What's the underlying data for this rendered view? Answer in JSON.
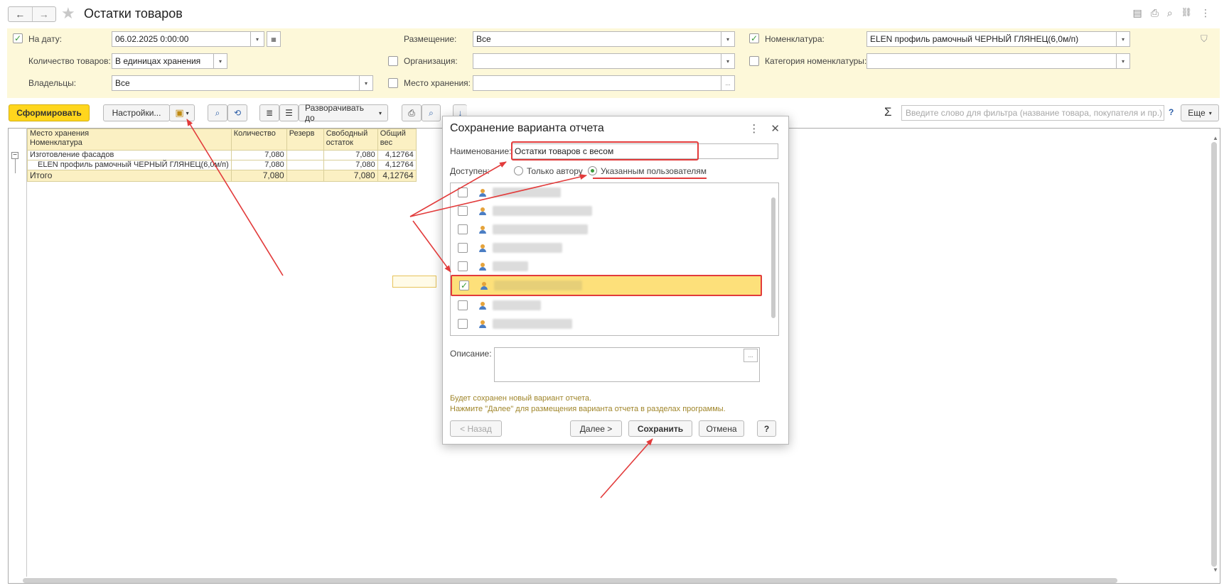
{
  "window": {
    "title": "Остатки товаров",
    "back_icon": "←",
    "forward_icon": "→",
    "star_icon": "★",
    "icons": [
      "save-icon",
      "print-icon",
      "preview-icon",
      "link-icon",
      "more-icon"
    ],
    "icon_glyphs": [
      "▤",
      "⎙",
      "⌕",
      "🔗",
      "⋮"
    ]
  },
  "filters": {
    "date": {
      "label": "На дату:",
      "value": "06.02.2025  0:00:00",
      "checked": true
    },
    "qty": {
      "label": "Количество товаров:",
      "value": "В единицах хранения"
    },
    "owners": {
      "label": "Владельцы:",
      "value": "Все"
    },
    "placement": {
      "label": "Размещение:",
      "value": "Все"
    },
    "org": {
      "label": "Организация:",
      "value": ""
    },
    "storage": {
      "label": "Место хранения:",
      "value": ""
    },
    "nomenclature": {
      "label": "Номенклатура:",
      "value": "ELEN профиль рамочный  ЧЕРНЫЙ ГЛЯНЕЦ(6,0м/п)",
      "checked": true
    },
    "category": {
      "label": "Категория номенклатуры:",
      "value": ""
    },
    "ellipsis": "...",
    "dd": "▾",
    "cal": "▦",
    "check": "✓",
    "funnel": "⛉"
  },
  "toolbar": {
    "generate": "Сформировать",
    "settings": "Настройки...",
    "expand": "Разворачивать до",
    "search_placeholder": "Введите слово для фильтра (название товара, покупателя и пр.)",
    "help": "?",
    "more": "Еще",
    "sigma": "Σ"
  },
  "report": {
    "headers": {
      "col1_a": "Место хранения",
      "col1_b": "Номенклатура",
      "qty": "Количество",
      "reserve": "Резерв",
      "free_a": "Свободный",
      "free_b": "остаток",
      "weight_a": "Общий",
      "weight_b": "вес"
    },
    "rows": [
      {
        "name": "Изготовление фасадов",
        "qty": "7,080",
        "reserve": "",
        "free": "7,080",
        "weight": "4,12764"
      },
      {
        "name": "ELEN профиль рамочный  ЧЕРНЫЙ ГЛЯНЕЦ(6,0м/п)",
        "qty": "7,080",
        "reserve": "",
        "free": "7,080",
        "weight": "4,12764"
      }
    ],
    "total": {
      "name": "Итого",
      "qty": "7,080",
      "reserve": "",
      "free": "7,080",
      "weight": "4,12764"
    },
    "collapse_glyph": "−"
  },
  "dialog": {
    "title": "Сохранение варианта отчета",
    "more_icon": "⋮",
    "close_icon": "✕",
    "name_label": "Наименование:",
    "name_value": "Остатки товаров с весом",
    "access_label": "Доступен:",
    "radio_author": "Только автору",
    "radio_users": "Указанным пользователям",
    "users": [
      {
        "checked": false,
        "blur_w": 96
      },
      {
        "checked": false,
        "blur_w": 140
      },
      {
        "checked": false,
        "blur_w": 134
      },
      {
        "checked": false,
        "blur_w": 98
      },
      {
        "checked": false,
        "blur_w": 50
      },
      {
        "checked": true,
        "blur_w": 124
      },
      {
        "checked": false,
        "blur_w": 68
      },
      {
        "checked": false,
        "blur_w": 112
      }
    ],
    "desc_label": "Описание:",
    "hint1": "Будет сохранен новый вариант отчета.",
    "hint2": "Нажмите \"Далее\" для размещения варианта отчета в разделах программы.",
    "back": "< Назад",
    "next": "Далее >",
    "save": "Сохранить",
    "cancel": "Отмена",
    "help": "?"
  },
  "annotation_color": "#e23b3b"
}
